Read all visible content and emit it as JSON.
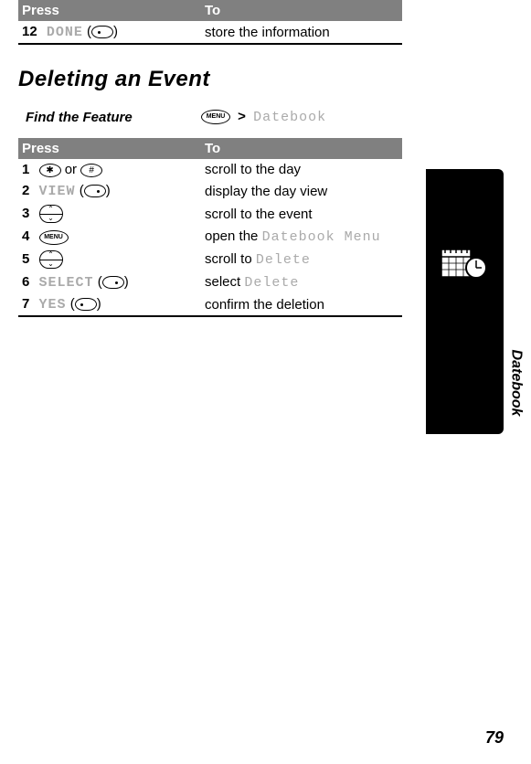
{
  "topTable": {
    "headers": {
      "press": "Press",
      "to": "To"
    },
    "row": {
      "num": "12",
      "action": "DONE",
      "description": "store the information"
    }
  },
  "heading": "Deleting an Event",
  "findFeature": {
    "label": "Find the Feature",
    "gt": ">",
    "target": "Datebook"
  },
  "mainTable": {
    "headers": {
      "press": "Press",
      "to": "To"
    },
    "rows": [
      {
        "num": "1",
        "orWord": "or",
        "description": "scroll to the day"
      },
      {
        "num": "2",
        "action": "VIEW",
        "description": "display the day view"
      },
      {
        "num": "3",
        "description": "scroll to the event"
      },
      {
        "num": "4",
        "descPrefix": "open the ",
        "descMono": "Datebook Menu"
      },
      {
        "num": "5",
        "descPrefix": "scroll to ",
        "descMono": "Delete"
      },
      {
        "num": "6",
        "action": "SELECT",
        "descPrefix": "select ",
        "descMono": "Delete"
      },
      {
        "num": "7",
        "action": "YES",
        "description": "confirm the deletion"
      }
    ]
  },
  "sideTab": "Datebook",
  "pageNumber": "79"
}
